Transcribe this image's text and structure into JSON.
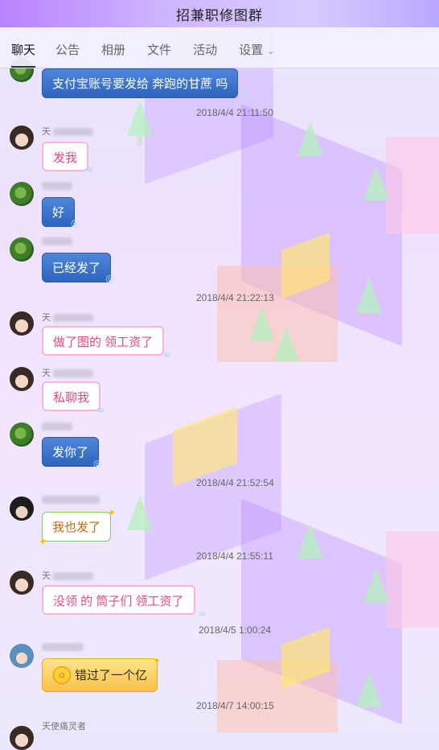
{
  "window": {
    "title": "招兼职修图群"
  },
  "tabs": [
    {
      "label": "聊天",
      "active": true
    },
    {
      "label": "公告",
      "active": false
    },
    {
      "label": "相册",
      "active": false
    },
    {
      "label": "文件",
      "active": false
    },
    {
      "label": "活动",
      "active": false
    },
    {
      "label": "设置",
      "active": false,
      "has_dropdown": true
    }
  ],
  "messages": [
    {
      "type": "msg",
      "sender": "",
      "avatar": "green",
      "style": "blue",
      "text": "支付宝账号要发给   奔跑的甘蔗  吗"
    },
    {
      "type": "time",
      "text": "2018/4/4 21:11:50"
    },
    {
      "type": "msg",
      "sender": "天",
      "avatar": "girl",
      "style": "pink",
      "text": "发我"
    },
    {
      "type": "msg",
      "sender": "",
      "avatar": "green",
      "style": "blue",
      "text": "好"
    },
    {
      "type": "msg",
      "sender": "",
      "avatar": "green",
      "style": "blue",
      "text": "已经发了"
    },
    {
      "type": "time",
      "text": "2018/4/4 21:22:13"
    },
    {
      "type": "msg",
      "sender": "天",
      "avatar": "girl",
      "style": "pink",
      "text": "做了图的   领工资了"
    },
    {
      "type": "msg",
      "sender": "天",
      "avatar": "girl",
      "style": "pink",
      "text": "私聊我"
    },
    {
      "type": "msg",
      "sender": "",
      "avatar": "green",
      "style": "blue",
      "text": "发你了"
    },
    {
      "type": "time",
      "text": "2018/4/4 21:52:54"
    },
    {
      "type": "msg",
      "sender": "",
      "avatar": "boy",
      "style": "green",
      "text": "我也发了"
    },
    {
      "type": "time",
      "text": "2018/4/4 21:55:11"
    },
    {
      "type": "msg",
      "sender": "天",
      "avatar": "girl",
      "style": "pink",
      "text": "没领 的 筒子们  领工资了"
    },
    {
      "type": "time",
      "text": "2018/4/5 1:00:24"
    },
    {
      "type": "msg",
      "sender": "",
      "avatar": "sky",
      "style": "yellow",
      "text": "错过了一个亿"
    },
    {
      "type": "time",
      "text": "2018/4/7 14:00:15"
    },
    {
      "type": "msg",
      "sender": "天使痛灵者",
      "avatar": "girl",
      "style": "none",
      "text": ""
    }
  ],
  "icons": {
    "dropdown": "chevron-down-icon",
    "emoji": "astonished-emoji-icon"
  }
}
